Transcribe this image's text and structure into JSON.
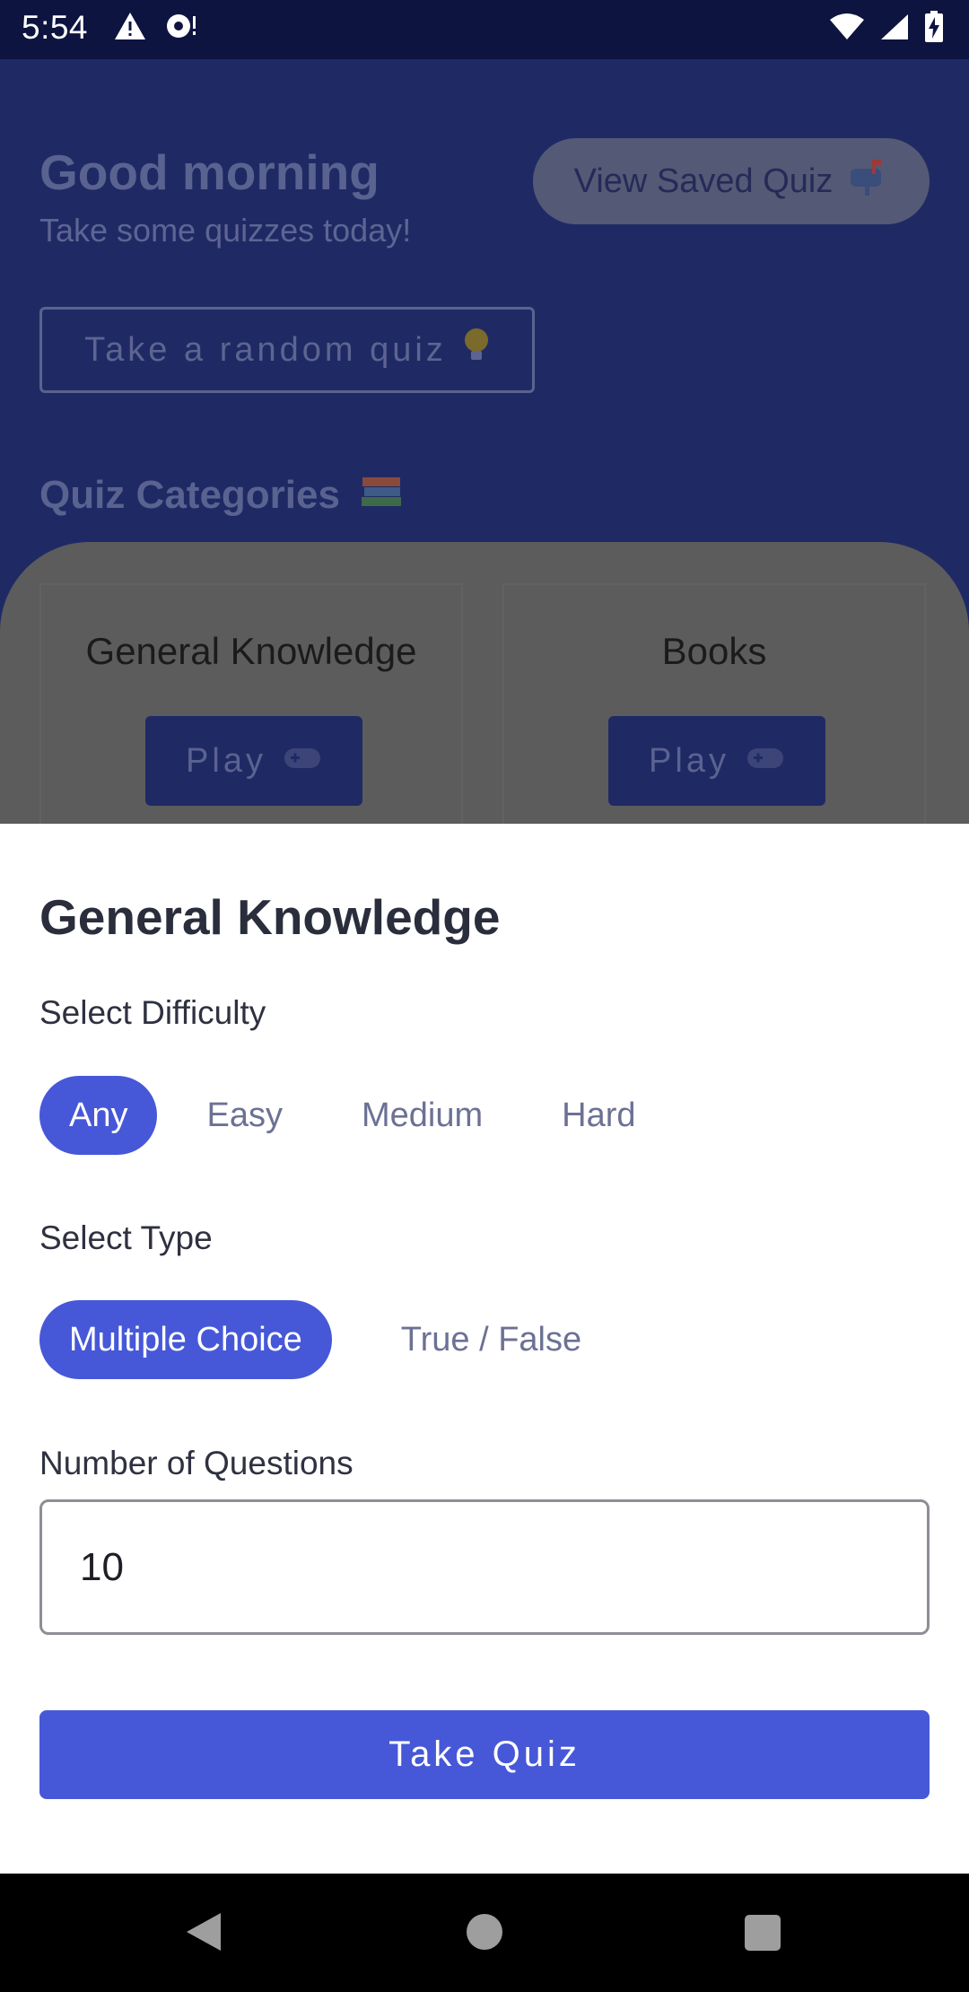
{
  "status_bar": {
    "time": "5:54",
    "icons": [
      "warning-icon",
      "sync-alert-icon",
      "wifi-icon",
      "signal-icon",
      "battery-charging-icon"
    ]
  },
  "home": {
    "greeting": "Good morning",
    "subtitle": "Take some quizzes today!",
    "saved_button": {
      "label": "View Saved Quiz",
      "icon": "mailbox-icon"
    },
    "random_button": {
      "label": "Take a random quiz",
      "icon": "lightbulb-icon"
    },
    "categories_heading": "Quiz Categories",
    "categories_icon": "books-icon",
    "categories": [
      {
        "name": "General Knowledge",
        "play_label": "Play",
        "play_icon": "game-controller-icon"
      },
      {
        "name": "Books",
        "play_label": "Play",
        "play_icon": "game-controller-icon"
      }
    ]
  },
  "sheet": {
    "title": "General Knowledge",
    "difficulty_label": "Select Difficulty",
    "difficulty_options": [
      "Any",
      "Easy",
      "Medium",
      "Hard"
    ],
    "difficulty_selected": "Any",
    "type_label": "Select Type",
    "type_options": [
      "Multiple Choice",
      "True / False"
    ],
    "type_selected": "Multiple Choice",
    "questions_label": "Number of Questions",
    "questions_value": "10",
    "submit_label": "Take Quiz"
  },
  "colors": {
    "accent": "#4658d8",
    "primary_dark": "#1f2a65",
    "status_bar": "#0e1440"
  }
}
